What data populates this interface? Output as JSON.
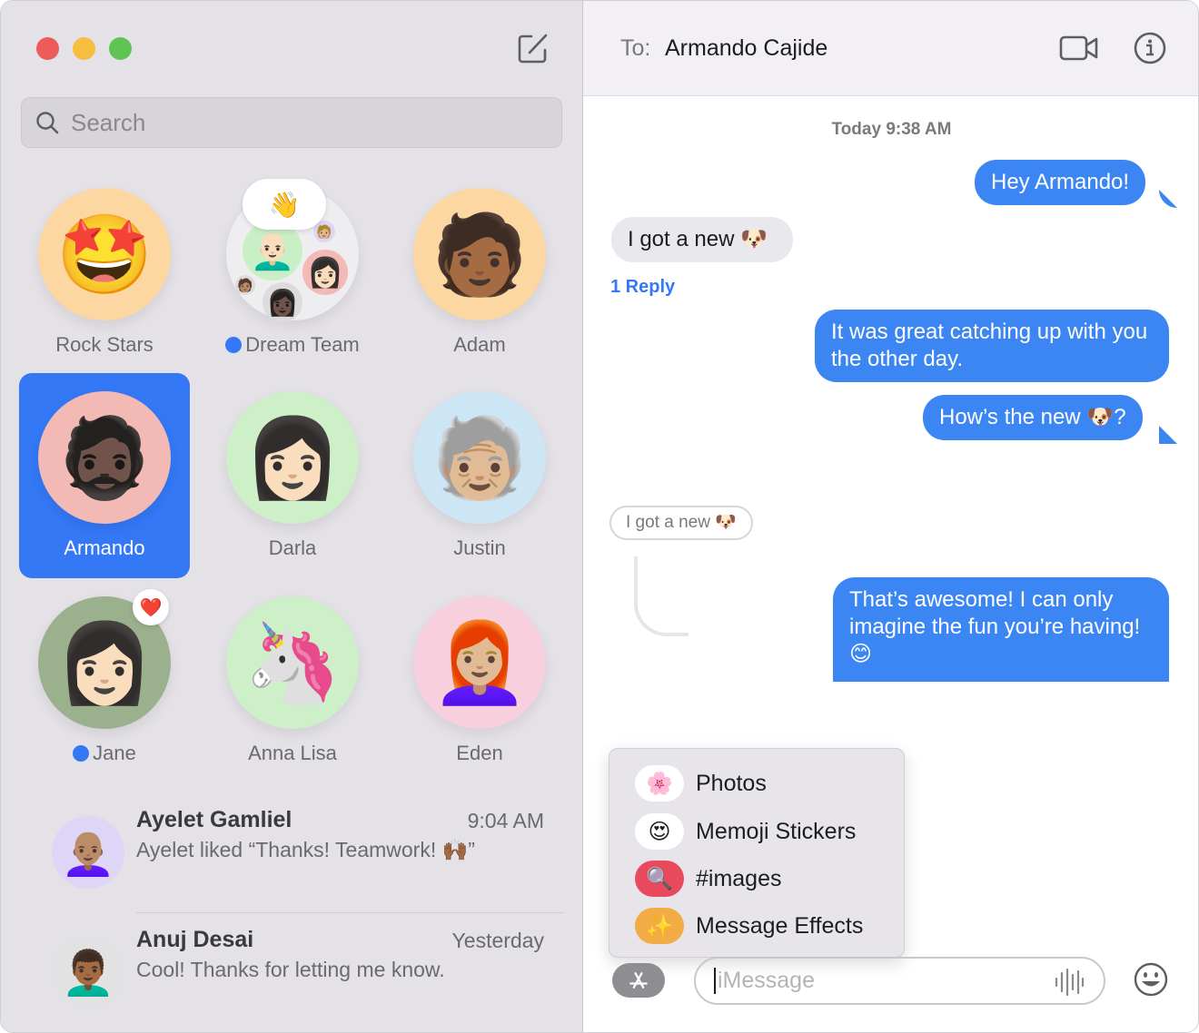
{
  "sidebar": {
    "compose_icon": "compose-icon",
    "search": {
      "placeholder": "Search",
      "value": ""
    },
    "pins": [
      {
        "name": "Rock Stars",
        "emoji": "🤩",
        "bg": "#fcd7a2",
        "unread": false,
        "selected": false
      },
      {
        "name": "Dream Team",
        "emoji": "👋",
        "bg": "#eeedf0",
        "unread": true,
        "selected": false,
        "group": true
      },
      {
        "name": "Adam",
        "emoji": "🧑🏾",
        "bg": "#fcd7a2",
        "unread": false,
        "selected": false
      },
      {
        "name": "Armando",
        "emoji": "🧔🏿",
        "bg": "#f3b9b5",
        "unread": false,
        "selected": true
      },
      {
        "name": "Darla",
        "emoji": "👩🏻",
        "bg": "#cdf0c9",
        "unread": false,
        "selected": false
      },
      {
        "name": "Justin",
        "emoji": "🧓🏼",
        "bg": "#cce6f6",
        "unread": false,
        "selected": false
      },
      {
        "name": "Jane",
        "emoji": "👩🏻",
        "bg": "#9bb08c",
        "unread": true,
        "selected": false,
        "badge": "❤️"
      },
      {
        "name": "Anna Lisa",
        "emoji": "🦄",
        "bg": "#cdf0c9",
        "unread": false,
        "selected": false
      },
      {
        "name": "Eden",
        "emoji": "👩🏼‍🦰",
        "bg": "#f8cfdc",
        "unread": false,
        "selected": false
      }
    ],
    "conversations": [
      {
        "name": "Ayelet Gamliel",
        "time": "9:04 AM",
        "preview": "Ayelet liked “Thanks! Teamwork! 🙌🏾”",
        "emoji": "👩🏽‍🦲",
        "bg": "#ddd6f7"
      },
      {
        "name": "Anuj Desai",
        "time": "Yesterday",
        "preview": "Cool! Thanks for letting me know.",
        "emoji": "👨🏾‍🦱",
        "bg": "#e2e2e2"
      }
    ]
  },
  "main": {
    "header": {
      "to_label": "To:",
      "recipient": "Armando Cajide",
      "video_icon": "video-camera-icon",
      "info_icon": "info-icon"
    },
    "timestamp": "Today 9:38 AM",
    "messages": [
      {
        "direction": "out",
        "text": "Hey Armando!"
      },
      {
        "direction": "in",
        "text": "I got a new 🐶"
      },
      {
        "direction": "out",
        "text": "It was great catching up with you the other day."
      },
      {
        "direction": "out",
        "text": "How’s the new 🐶?"
      },
      {
        "direction": "in-thread",
        "text": "I got a new 🐶"
      },
      {
        "direction": "out",
        "text": "That’s awesome! I can only imagine the fun you’re having! 😊"
      }
    ],
    "reply_link": "1 Reply",
    "apps_menu": [
      {
        "label": "Photos",
        "icon": "🌸",
        "bg": "#ffffff"
      },
      {
        "label": "Memoji Stickers",
        "icon": "😍",
        "bg": "#ffffff"
      },
      {
        "label": "#images",
        "icon": "🔍",
        "bg": "#e8495d"
      },
      {
        "label": "Message Effects",
        "icon": "✨",
        "bg": "#f2ac45"
      }
    ],
    "composer": {
      "placeholder": "iMessage",
      "value": ""
    }
  },
  "colors": {
    "accent": "#3478f6",
    "bubble_out": "#3b86f2",
    "bubble_in": "#e9e8ec",
    "sidebar_bg": "#e4e1e7"
  }
}
